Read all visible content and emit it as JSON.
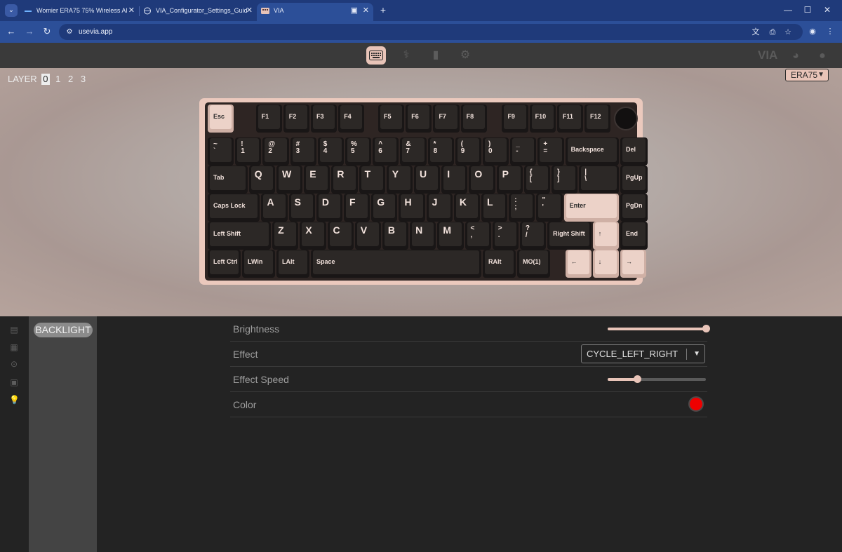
{
  "browser": {
    "tabs": [
      {
        "title": "Womier ERA75 75% Wireless Al",
        "active": false
      },
      {
        "title": "VIA_Configurator_Settings_Guid",
        "active": false
      },
      {
        "title": "VIA",
        "active": true
      }
    ],
    "url": "usevia.app"
  },
  "via": {
    "brand": "VIA",
    "layer_label": "LAYER",
    "layers": [
      "0",
      "1",
      "2",
      "3"
    ],
    "active_layer": "0",
    "keyboard_name": "ERA75",
    "submenu_item": "BACKLIGHT",
    "settings": {
      "brightness_label": "Brightness",
      "brightness_value": 1.0,
      "effect_label": "Effect",
      "effect_value": "CYCLE_LEFT_RIGHT",
      "speed_label": "Effect Speed",
      "speed_value": 0.3,
      "color_label": "Color",
      "color_value": "#ee0000"
    },
    "accent_color": "#e8c4b8",
    "key_rows": [
      [
        "Esc",
        "F1",
        "F2",
        "F3",
        "F4",
        "F5",
        "F6",
        "F7",
        "F8",
        "F9",
        "F10",
        "F11",
        "F12"
      ],
      [
        "~\n`",
        "!\n1",
        "@\n2",
        "#\n3",
        "$\n4",
        "%\n5",
        "^\n6",
        "&\n7",
        "*\n8",
        "(\n9",
        ")\n0",
        "_\n-",
        "+\n=",
        "Backspace",
        "Del"
      ],
      [
        "Tab",
        "Q",
        "W",
        "E",
        "R",
        "T",
        "Y",
        "U",
        "I",
        "O",
        "P",
        "{\n[",
        "}\n]",
        "|\n\\",
        "PgUp"
      ],
      [
        "Caps Lock",
        "A",
        "S",
        "D",
        "F",
        "G",
        "H",
        "J",
        "K",
        "L",
        ":\n;",
        "\"\n'",
        "Enter",
        "PgDn"
      ],
      [
        "Left Shift",
        "Z",
        "X",
        "C",
        "V",
        "B",
        "N",
        "M",
        "<\n,",
        ">\n.",
        "?\n/",
        "Right Shift",
        "↑",
        "End"
      ],
      [
        "Left Ctrl",
        "LWin",
        "LAlt",
        "Space",
        "RAlt",
        "MO(1)",
        "←",
        "↓",
        "→"
      ]
    ]
  }
}
